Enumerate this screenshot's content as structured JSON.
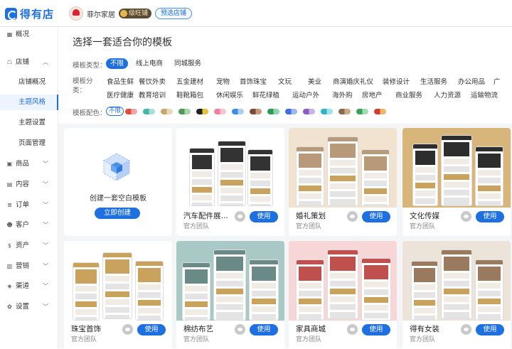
{
  "brand": {
    "name": "得有店"
  },
  "shop": {
    "name": "菲尔家居",
    "badge": "级旺铺",
    "preview": "预选店铺"
  },
  "sidebar": {
    "items": [
      {
        "label": "概况",
        "icon": "grid-icon"
      },
      {
        "label": "店铺",
        "icon": "store-icon"
      },
      {
        "label": "商品",
        "icon": "box-icon"
      },
      {
        "label": "内容",
        "icon": "content-icon"
      },
      {
        "label": "订单",
        "icon": "order-icon"
      },
      {
        "label": "客户",
        "icon": "customer-icon"
      },
      {
        "label": "资产",
        "icon": "dollar-icon"
      },
      {
        "label": "营销",
        "icon": "marketing-icon"
      },
      {
        "label": "渠道",
        "icon": "channel-icon"
      },
      {
        "label": "设置",
        "icon": "gear-icon"
      }
    ],
    "store_sub": [
      "店铺概况",
      "主题风格",
      "主题设置",
      "页面管理"
    ],
    "active_sub": "主题风格"
  },
  "filter": {
    "heading": "选择一套适合你的模板",
    "type_label": "模板类型：",
    "types": [
      "不限",
      "线上电商",
      "同城服务"
    ],
    "category_label": "模板分类：",
    "categories_row1": [
      "食品生鲜",
      "餐饮外卖",
      "五金建材",
      "宠物",
      "首饰珠宝",
      "文玩",
      "美业",
      "商演婚庆礼仪",
      "装修设计",
      "生活服务",
      "办公用品",
      "广"
    ],
    "categories_row2": [
      "医疗健康",
      "教育培训",
      "鞋靴箱包",
      "休闲娱乐",
      "鲜花绿植",
      "运动户外",
      "海外购",
      "房地产",
      "商业服务",
      "人力资源",
      "运输物流"
    ],
    "color_label": "模板配色：",
    "color_all": "不限",
    "colors": [
      [
        "#ea4a3a",
        "#f0a6b0"
      ],
      [
        "#3fb8a8",
        "#a8e0d8"
      ],
      [
        "#c9a76a",
        "#e9d9b5"
      ],
      [
        "#4d9a57",
        "#a8d6a8"
      ],
      [
        "#222222",
        "#e6c23a"
      ],
      [
        "#f27ea0",
        "#f9c4d2"
      ],
      [
        "#3a8ee6",
        "#a9d0f5"
      ],
      [
        "#7a4a3a",
        "#c79a7a"
      ],
      [
        "#2e9a5a",
        "#8fd4a6"
      ],
      [
        "#3e6ee0",
        "#9fb8f2"
      ],
      [
        "#8a5cc8",
        "#c8b2ee"
      ],
      [
        "#2bb3c9",
        "#9ee3ec"
      ],
      [
        "#8a6a4a",
        "#caa986"
      ],
      [
        "#3aa35a",
        "#a6dcb4"
      ],
      [
        "#d63a3a",
        "#e9b86a"
      ]
    ]
  },
  "blank_card": {
    "text": "创建一套空白模板",
    "button": "立即创建"
  },
  "templates": [
    {
      "title": "汽车配件展示...",
      "team": "官方团队",
      "use": "使用",
      "bg": "#ffffff",
      "accent": "#333333"
    },
    {
      "title": "婚礼策划",
      "team": "官方团队",
      "use": "使用",
      "bg": "#f1e3d0",
      "accent": "#b89a7a"
    },
    {
      "title": "文化传媒",
      "team": "官方团队",
      "use": "使用",
      "bg": "#d8b57a",
      "accent": "#2d2d2d"
    },
    {
      "title": "珠宝首饰",
      "team": "官方团队",
      "use": "使用",
      "bg": "#ffffff",
      "accent": "#c9a35e"
    },
    {
      "title": "棉纺布艺",
      "team": "官方团队",
      "use": "使用",
      "bg": "#a9c9c6",
      "accent": "#6a8a88"
    },
    {
      "title": "家具商城",
      "team": "官方团队",
      "use": "使用",
      "bg": "#f7d6d8",
      "accent": "#c0504d"
    },
    {
      "title": "得有女装",
      "team": "官方团队",
      "use": "使用",
      "bg": "#ece3d9",
      "accent": "#9a7a5e"
    }
  ]
}
